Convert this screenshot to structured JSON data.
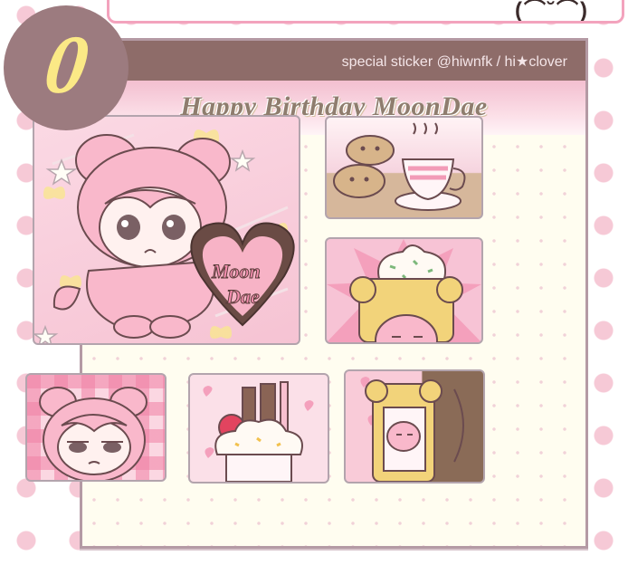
{
  "badge": {
    "number": "0"
  },
  "banner": {
    "glyphs": "(⌒˘⌒)"
  },
  "sheet": {
    "credit": "special sticker  @hiwnfk / hi★clover",
    "title": "Happy Birthday MoonDae"
  },
  "stickers": {
    "main": {
      "heart_text_line1": "Moon",
      "heart_text_line2": "Dae"
    },
    "pudding": {
      "icon": "pudding-icon"
    },
    "food": {
      "icon": "cookies-and-tea-icon"
    },
    "check": {
      "icon": "bear-face-icon"
    },
    "parfait": {
      "icon": "parfait-icon"
    },
    "coffee": {
      "icon": "coffee-icon"
    }
  },
  "colors": {
    "header": "#8e6c69",
    "accent_pink": "#f3bfd0",
    "badge": "#9c7b7f",
    "badge_text": "#fbe986"
  }
}
